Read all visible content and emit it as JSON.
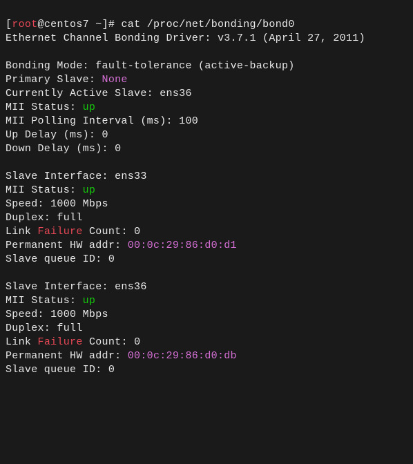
{
  "prompt": {
    "user": "root",
    "host": "centos7",
    "cwd": "~",
    "cmd": "cat /proc/net/bonding/bond0"
  },
  "header": {
    "driver": "Ethernet Channel Bonding Driver: v3.7.1 (April 27, 2011)"
  },
  "bond": {
    "mode_label": "Bonding Mode: ",
    "mode": "fault-tolerance (active-backup)",
    "primary_label": "Primary Slave: ",
    "primary": "None",
    "active_label": "Currently Active Slave: ",
    "active": "ens36",
    "mii_label": "MII Status: ",
    "mii": "up",
    "poll_label": "MII Polling Interval (ms): ",
    "poll": "100",
    "updelay_label": "Up Delay (ms): ",
    "updelay": "0",
    "downdelay_label": "Down Delay (ms): ",
    "downdelay": "0"
  },
  "slaves": [
    {
      "iface_label": "Slave Interface: ",
      "iface": "ens33",
      "mii_label": "MII Status: ",
      "mii": "up",
      "speed_label": "Speed: ",
      "speed": "1000 Mbps",
      "duplex_label": "Duplex: ",
      "duplex": "full",
      "lf_prefix": "Link ",
      "lf_word": "Failure",
      "lf_suffix": " Count: ",
      "lf_val": "0",
      "hw_label": "Permanent HW addr: ",
      "hw": "00:0c:29:86:d0:d1",
      "q_label": "Slave queue ID: ",
      "q": "0"
    },
    {
      "iface_label": "Slave Interface: ",
      "iface": "ens36",
      "mii_label": "MII Status: ",
      "mii": "up",
      "speed_label": "Speed: ",
      "speed": "1000 Mbps",
      "duplex_label": "Duplex: ",
      "duplex": "full",
      "lf_prefix": "Link ",
      "lf_word": "Failure",
      "lf_suffix": " Count: ",
      "lf_val": "0",
      "hw_label": "Permanent HW addr: ",
      "hw": "00:0c:29:86:d0:db",
      "q_label": "Slave queue ID: ",
      "q": "0"
    }
  ]
}
